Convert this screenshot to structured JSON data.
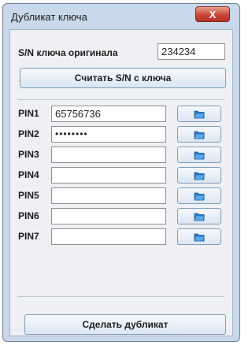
{
  "window": {
    "title": "Дубликат ключа",
    "close_label": "X"
  },
  "original": {
    "label": "S/N ключа оригинала",
    "value": "234234"
  },
  "read_button": "Считать S/N с ключа",
  "pins": [
    {
      "label": "PIN1",
      "value": "65756736"
    },
    {
      "label": "PIN2",
      "value": "••••••••"
    },
    {
      "label": "PIN3",
      "value": ""
    },
    {
      "label": "PIN4",
      "value": ""
    },
    {
      "label": "PIN5",
      "value": ""
    },
    {
      "label": "PIN6",
      "value": ""
    },
    {
      "label": "PIN7",
      "value": ""
    }
  ],
  "make_button": "Сделать дубликат",
  "colors": {
    "close_button": "#c9463a",
    "folder_icon": "#2a7fd0"
  }
}
